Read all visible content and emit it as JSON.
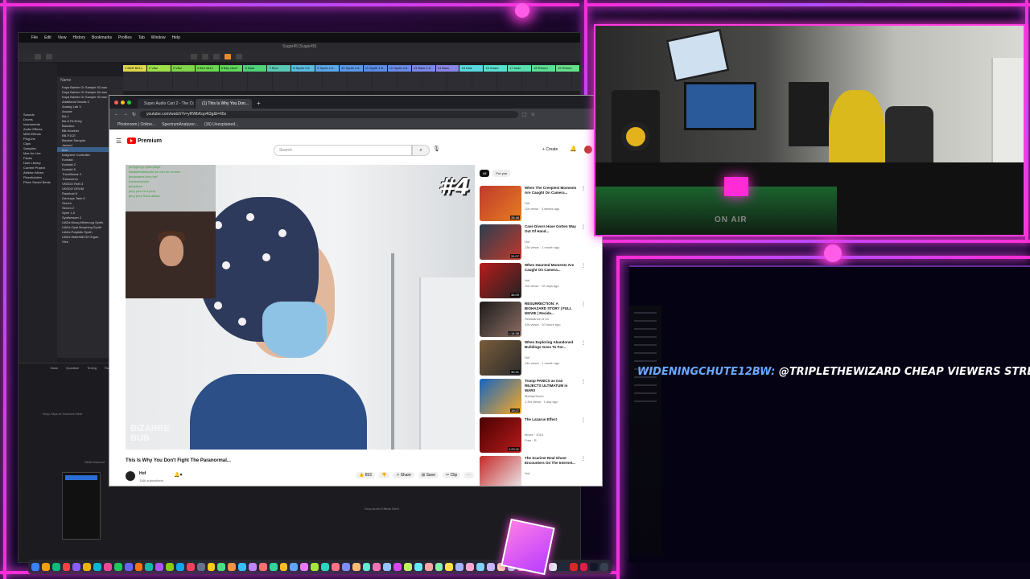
{
  "daw": {
    "menu": [
      "File",
      "Edit",
      "View",
      "History",
      "Bookmarks",
      "Profiles",
      "Tab",
      "Window",
      "Help"
    ],
    "window_title": "Sugar45 [Sugar45]",
    "browser_header": "Name",
    "browser_items": [
      "Kaya Barber Gr Sample 92.wav",
      "Kaya Barber Gr Sample 62.wav",
      "Kaya Barber Gr Sample 92.wav",
      "Additional Vocals 2",
      "Analog Lab V",
      "Arcade",
      "BA-1",
      "BA-5 Fit Entry",
      "Basstino",
      "BB-Hornber",
      "BB-F1CE",
      "Blanket Sampler",
      "Jacked",
      "Ima",
      "Insignere Controller",
      "Kontakt",
      "Kontakt 2",
      "Kontakt 5",
      "Travellinear 2",
      "Transverso",
      "VKEDO RnB 3",
      "VKEDO DRUM",
      "Raselcat 6",
      "Genesys Tank 6",
      "Serum",
      "Serum 2",
      "Spire 1.5",
      "Synthesizer 2",
      "UADs Moog Minimoog Synth",
      "UADs Opal Morphing Synth",
      "UADs Polyiktik Synth",
      "UADs Waterfall B3 Organ",
      "Xfce"
    ],
    "left_items": [
      "Sounds",
      "Drums",
      "Instruments",
      "Audio Effects",
      "MIDI Effects",
      "Plug-Ins",
      "Clips",
      "Samples",
      "Max for Live",
      "Packs",
      "User Library",
      "Current Project",
      "Ableton Mixes",
      "Placeholders",
      "Place Saved Beats"
    ],
    "scenes": [
      {
        "label": "1 BAR BELL",
        "color": "#e0d84a"
      },
      {
        "label": "2 Vibe",
        "color": "#9ee04a"
      },
      {
        "label": "3 Vibz",
        "color": "#7fd648"
      },
      {
        "label": "4 Bell 4814",
        "color": "#6cd84f"
      },
      {
        "label": "5 Bby vibz2",
        "color": "#5fd85a"
      },
      {
        "label": "6 Dark",
        "color": "#4fd27a"
      },
      {
        "label": "7 Sine",
        "color": "#58c9b2"
      },
      {
        "label": "8 Synth 1.6",
        "color": "#5abbe0"
      },
      {
        "label": "9 Synth 1.5",
        "color": "#5aa8e8"
      },
      {
        "label": "10 Synth 1.6",
        "color": "#5a98e8"
      },
      {
        "label": "11 Synth 1.6",
        "color": "#5a8ce8"
      },
      {
        "label": "12 Synth 1.6",
        "color": "#6a8ae8"
      },
      {
        "label": "13 Bass 1.6",
        "color": "#7a88e8"
      },
      {
        "label": "14 Bass",
        "color": "#8a86e8"
      },
      {
        "label": "15 Kick",
        "color": "#58d8e0"
      },
      {
        "label": "16 Snare",
        "color": "#58e0d0"
      },
      {
        "label": "17 Ionic",
        "color": "#58e0b0"
      },
      {
        "label": "18 Return",
        "color": "#5ae096"
      },
      {
        "label": "19 Return",
        "color": "#64e08a"
      }
    ],
    "detail_headers": [
      "Base",
      "Quantize",
      "Timing",
      "Random",
      "Velo"
    ],
    "drop_clips": "Drop Clips or Grooves Here",
    "drop_audio": "Drop Audio Effects Here",
    "drop_slider": "Slider Amount"
  },
  "browser": {
    "tabs": [
      "Super Audio Cart 2 - The Co...",
      "(1) This Is Why You Don..."
    ],
    "url": "youtube.com/watch?v=yRWbKqo4t3g&t=66s",
    "bookmarks": [
      "Photoroom | Online...",
      "SpectrumAnalyzer...",
      "(16) Unexplained..."
    ]
  },
  "youtube": {
    "logo": "Premium",
    "search_placeholder": "Search",
    "create_label": "Create",
    "video_title": "This Is Why You Don't Fight The Paranormal...",
    "channel_name": "Hof",
    "subscribers": "116k subscribers",
    "likes": "653",
    "share": "Share",
    "save": "Save",
    "clip": "Clip",
    "badge": "#4",
    "watermark": "BIZARRE BUB",
    "chat_lines": [
      "jerrryjerryy cyberplayd",
      "hawaiiantheworld we can be serious",
      "jerrywaters jerry red",
      "dontworryman",
      "jerrydean",
      "jerry yes it's a jerry",
      "jerry jerry Sans attack"
    ],
    "filters": [
      "All",
      "For you"
    ],
    "recommendations": [
      {
        "title": "When The Creepiest Moments Are Caught On Camera...",
        "channel": "Hof",
        "meta": "11k views · 3 weeks ago",
        "duration": "35:48"
      },
      {
        "title": "Cave Divers Have Gotten Way Out Of Hand...",
        "channel": "Hof",
        "meta": "13k views · 1 month ago",
        "duration": "31:07"
      },
      {
        "title": "When Haunted Moments Are Caught On Camera...",
        "channel": "Hof",
        "meta": "11k views · 12 days ago",
        "duration": "36:09"
      },
      {
        "title": "RESURRECTION: A BIOHAZARD STORY | FULL MOVIE | Reside...",
        "channel": "Resistance of 44",
        "meta": "42k views · 20 hours ago",
        "duration": "1:14:38"
      },
      {
        "title": "When Exploring Abandoned Buildings Goes To Far...",
        "channel": "Hof",
        "meta": "14k views · 1 month ago",
        "duration": "30:31"
      },
      {
        "title": "Trump PANICS as Iran REJECTS ULTIMATUM in WAR!!",
        "channel": "MeidasTouch",
        "meta": "1.3m views · 1 day ago",
        "duration": "19:27"
      },
      {
        "title": "The Lazarus Effect",
        "channel": "Movie · 2015",
        "meta": "Free · R",
        "duration": "1:23:11"
      },
      {
        "title": "The Scariest Real Ghost Encounters On The Internet...",
        "channel": "Hof",
        "meta": "",
        "duration": ""
      }
    ]
  },
  "webcam": {
    "sign": "ON AIR"
  },
  "ticker": {
    "user": "WIDENINGCHUTE12BW:",
    "message": "@TRIPLETHEWIZARD CHEAP VIEWERS STREAMBOO .COM (R"
  },
  "colors": {
    "neon_pink": "#ff2bd6",
    "neon_purple": "#b14cff",
    "ticker_blue": "#5fa8ff",
    "youtube_red": "#ff0000"
  }
}
